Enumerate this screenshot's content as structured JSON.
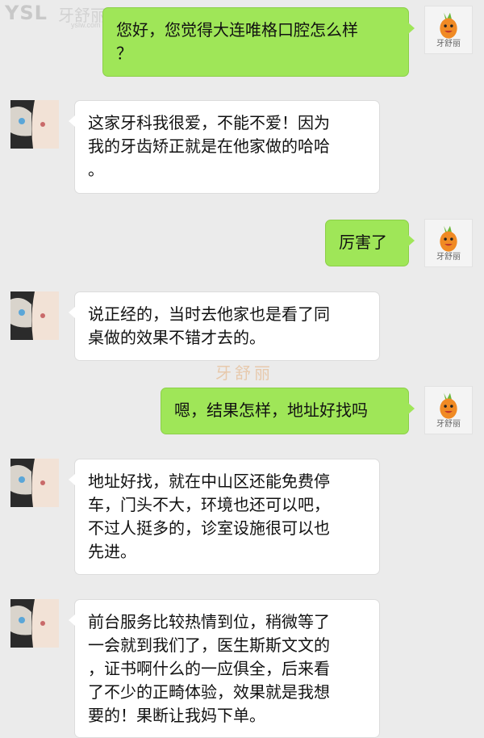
{
  "watermark": {
    "brand_latin": "YSL",
    "brand_cn": "牙舒丽",
    "url": "yslw.com",
    "center_text": "牙舒丽"
  },
  "avatars": {
    "me_caption": "牙舒丽"
  },
  "colors": {
    "background": "#ebebeb",
    "outgoing_bubble": "#9fe658",
    "incoming_bubble": "#ffffff",
    "logo_orange": "#f08a24"
  },
  "messages": [
    {
      "sender": "me",
      "lines": [
        "您好，您觉得大连唯格口腔怎么样",
        "？"
      ]
    },
    {
      "sender": "them",
      "lines": [
        "这家牙科我很爱，不能不爱！因为",
        "我的牙齿矫正就是在他家做的哈哈",
        "。"
      ]
    },
    {
      "sender": "me",
      "lines": [
        "厉害了"
      ]
    },
    {
      "sender": "them",
      "lines": [
        "说正经的，当时去他家也是看了同",
        "桌做的效果不错才去的。"
      ]
    },
    {
      "sender": "me",
      "lines": [
        "嗯，结果怎样，地址好找吗"
      ]
    },
    {
      "sender": "them",
      "lines": [
        "地址好找，就在中山区还能免费停",
        "车，门头不大，环境也还可以吧，",
        "不过人挺多的，诊室设施很可以也",
        "先进。"
      ]
    },
    {
      "sender": "them",
      "lines": [
        "前台服务比较热情到位，稍微等了",
        "一会就到我们了，医生斯斯文文的",
        "，证书啊什么的一应俱全，后来看",
        "了不少的正畸体验，效果就是我想",
        "要的！果断让我妈下单。"
      ]
    }
  ]
}
